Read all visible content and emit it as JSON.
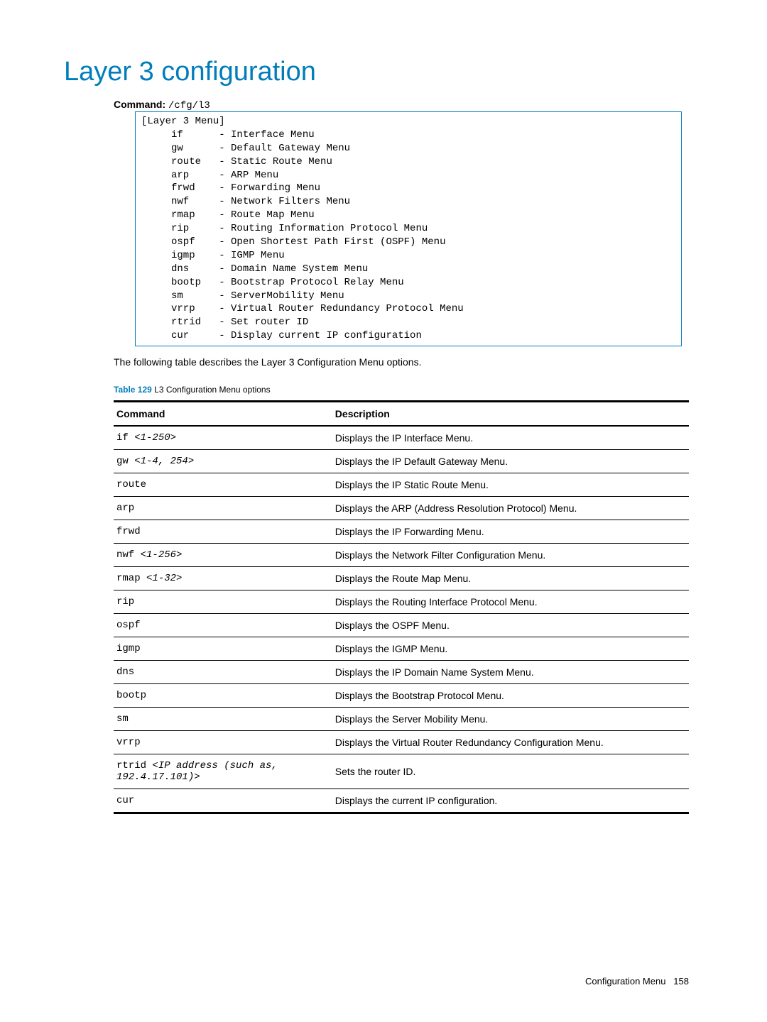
{
  "title": "Layer 3 configuration",
  "command_label": "Command:",
  "command_value": "/cfg/l3",
  "terminal": "[Layer 3 Menu]\n     if      - Interface Menu\n     gw      - Default Gateway Menu\n     route   - Static Route Menu\n     arp     - ARP Menu\n     frwd    - Forwarding Menu\n     nwf     - Network Filters Menu\n     rmap    - Route Map Menu\n     rip     - Routing Information Protocol Menu\n     ospf    - Open Shortest Path First (OSPF) Menu\n     igmp    - IGMP Menu\n     dns     - Domain Name System Menu\n     bootp   - Bootstrap Protocol Relay Menu\n     sm      - ServerMobility Menu\n     vrrp    - Virtual Router Redundancy Protocol Menu\n     rtrid   - Set router ID\n     cur     - Display current IP configuration",
  "intro": "The following table describes the Layer 3 Configuration Menu options.",
  "table_caption_label": "Table 129",
  "table_caption_desc": " L3 Configuration Menu options",
  "table": {
    "headers": {
      "command": "Command",
      "description": "Description"
    },
    "rows": [
      {
        "cmd_plain": "if ",
        "cmd_ital": "<1-250>",
        "desc": "Displays the IP Interface Menu."
      },
      {
        "cmd_plain": "gw ",
        "cmd_ital": "<1-4, 254>",
        "desc": "Displays the IP Default Gateway Menu."
      },
      {
        "cmd_plain": "route",
        "cmd_ital": "",
        "desc": "Displays the IP Static Route Menu."
      },
      {
        "cmd_plain": "arp",
        "cmd_ital": "",
        "desc": "Displays the ARP (Address Resolution Protocol) Menu."
      },
      {
        "cmd_plain": "frwd",
        "cmd_ital": "",
        "desc": "Displays the IP Forwarding Menu."
      },
      {
        "cmd_plain": "nwf ",
        "cmd_ital": "<1-256>",
        "desc": "Displays the Network Filter Configuration Menu."
      },
      {
        "cmd_plain": "rmap ",
        "cmd_ital": "<1-32>",
        "desc": "Displays the Route Map Menu."
      },
      {
        "cmd_plain": "rip",
        "cmd_ital": "",
        "desc": "Displays the Routing Interface Protocol Menu."
      },
      {
        "cmd_plain": "ospf",
        "cmd_ital": "",
        "desc": "Displays the OSPF Menu."
      },
      {
        "cmd_plain": "igmp",
        "cmd_ital": "",
        "desc": "Displays the IGMP Menu."
      },
      {
        "cmd_plain": "dns",
        "cmd_ital": "",
        "desc": "Displays the IP Domain Name System Menu."
      },
      {
        "cmd_plain": "bootp",
        "cmd_ital": "",
        "desc": "Displays the Bootstrap Protocol Menu."
      },
      {
        "cmd_plain": "sm",
        "cmd_ital": "",
        "desc": "Displays the Server Mobility Menu."
      },
      {
        "cmd_plain": "vrrp",
        "cmd_ital": "",
        "desc": "Displays the Virtual Router Redundancy Configuration Menu."
      },
      {
        "cmd_plain": "rtrid ",
        "cmd_ital": "<IP address (such as, 192.4.17.101)>",
        "desc": "Sets the router ID."
      },
      {
        "cmd_plain": "cur",
        "cmd_ital": "",
        "desc": "Displays the current IP configuration."
      }
    ]
  },
  "footer": {
    "text": "Configuration Menu",
    "page": "158"
  }
}
